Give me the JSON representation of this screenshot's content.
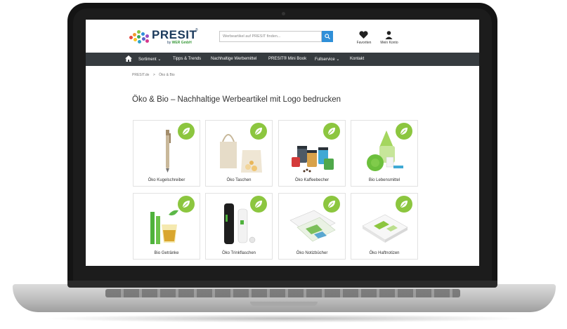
{
  "site": {
    "logo_text": "PRESIT",
    "logo_tm": "®",
    "logo_sub_prefix": "by",
    "logo_sub_brand": "WER GmbH",
    "search_placeholder": "Werbeartikel auf PRESIT finden...",
    "favorites_label": "Favoriten",
    "account_label": "Mein Konto"
  },
  "nav": {
    "items": [
      "Sortiment",
      "Tipps & Trends",
      "Nachhaltige Werbemittel",
      "PRESIT® Mini Book",
      "Fullservice",
      "Kontakt"
    ]
  },
  "breadcrumb": {
    "home": "PRESIT.de",
    "separator": ">",
    "current": "Öko & Bio"
  },
  "page": {
    "title": "Öko & Bio – Nachhaltige Werbeartikel mit Logo bedrucken"
  },
  "categories": [
    {
      "label": "Öko Kugelschreiber"
    },
    {
      "label": "Öko Taschen"
    },
    {
      "label": "Öko Kaffeebecher"
    },
    {
      "label": "Bio Lebensmittel"
    },
    {
      "label": "Bio Getränke"
    },
    {
      "label": "Öko Trinkflaschen"
    },
    {
      "label": "Öko Notizbücher"
    },
    {
      "label": "Öko Haftnotizen"
    }
  ],
  "colors": {
    "nav_bg": "#363b3f",
    "badge_green": "#8cc63f",
    "search_blue": "#2f8fd8",
    "brand_navy": "#1b3a5c"
  },
  "icons": {
    "badge": "leaf-icon",
    "home": "home-icon",
    "search": "search-icon",
    "favorites": "heart-icon",
    "account": "user-icon"
  }
}
